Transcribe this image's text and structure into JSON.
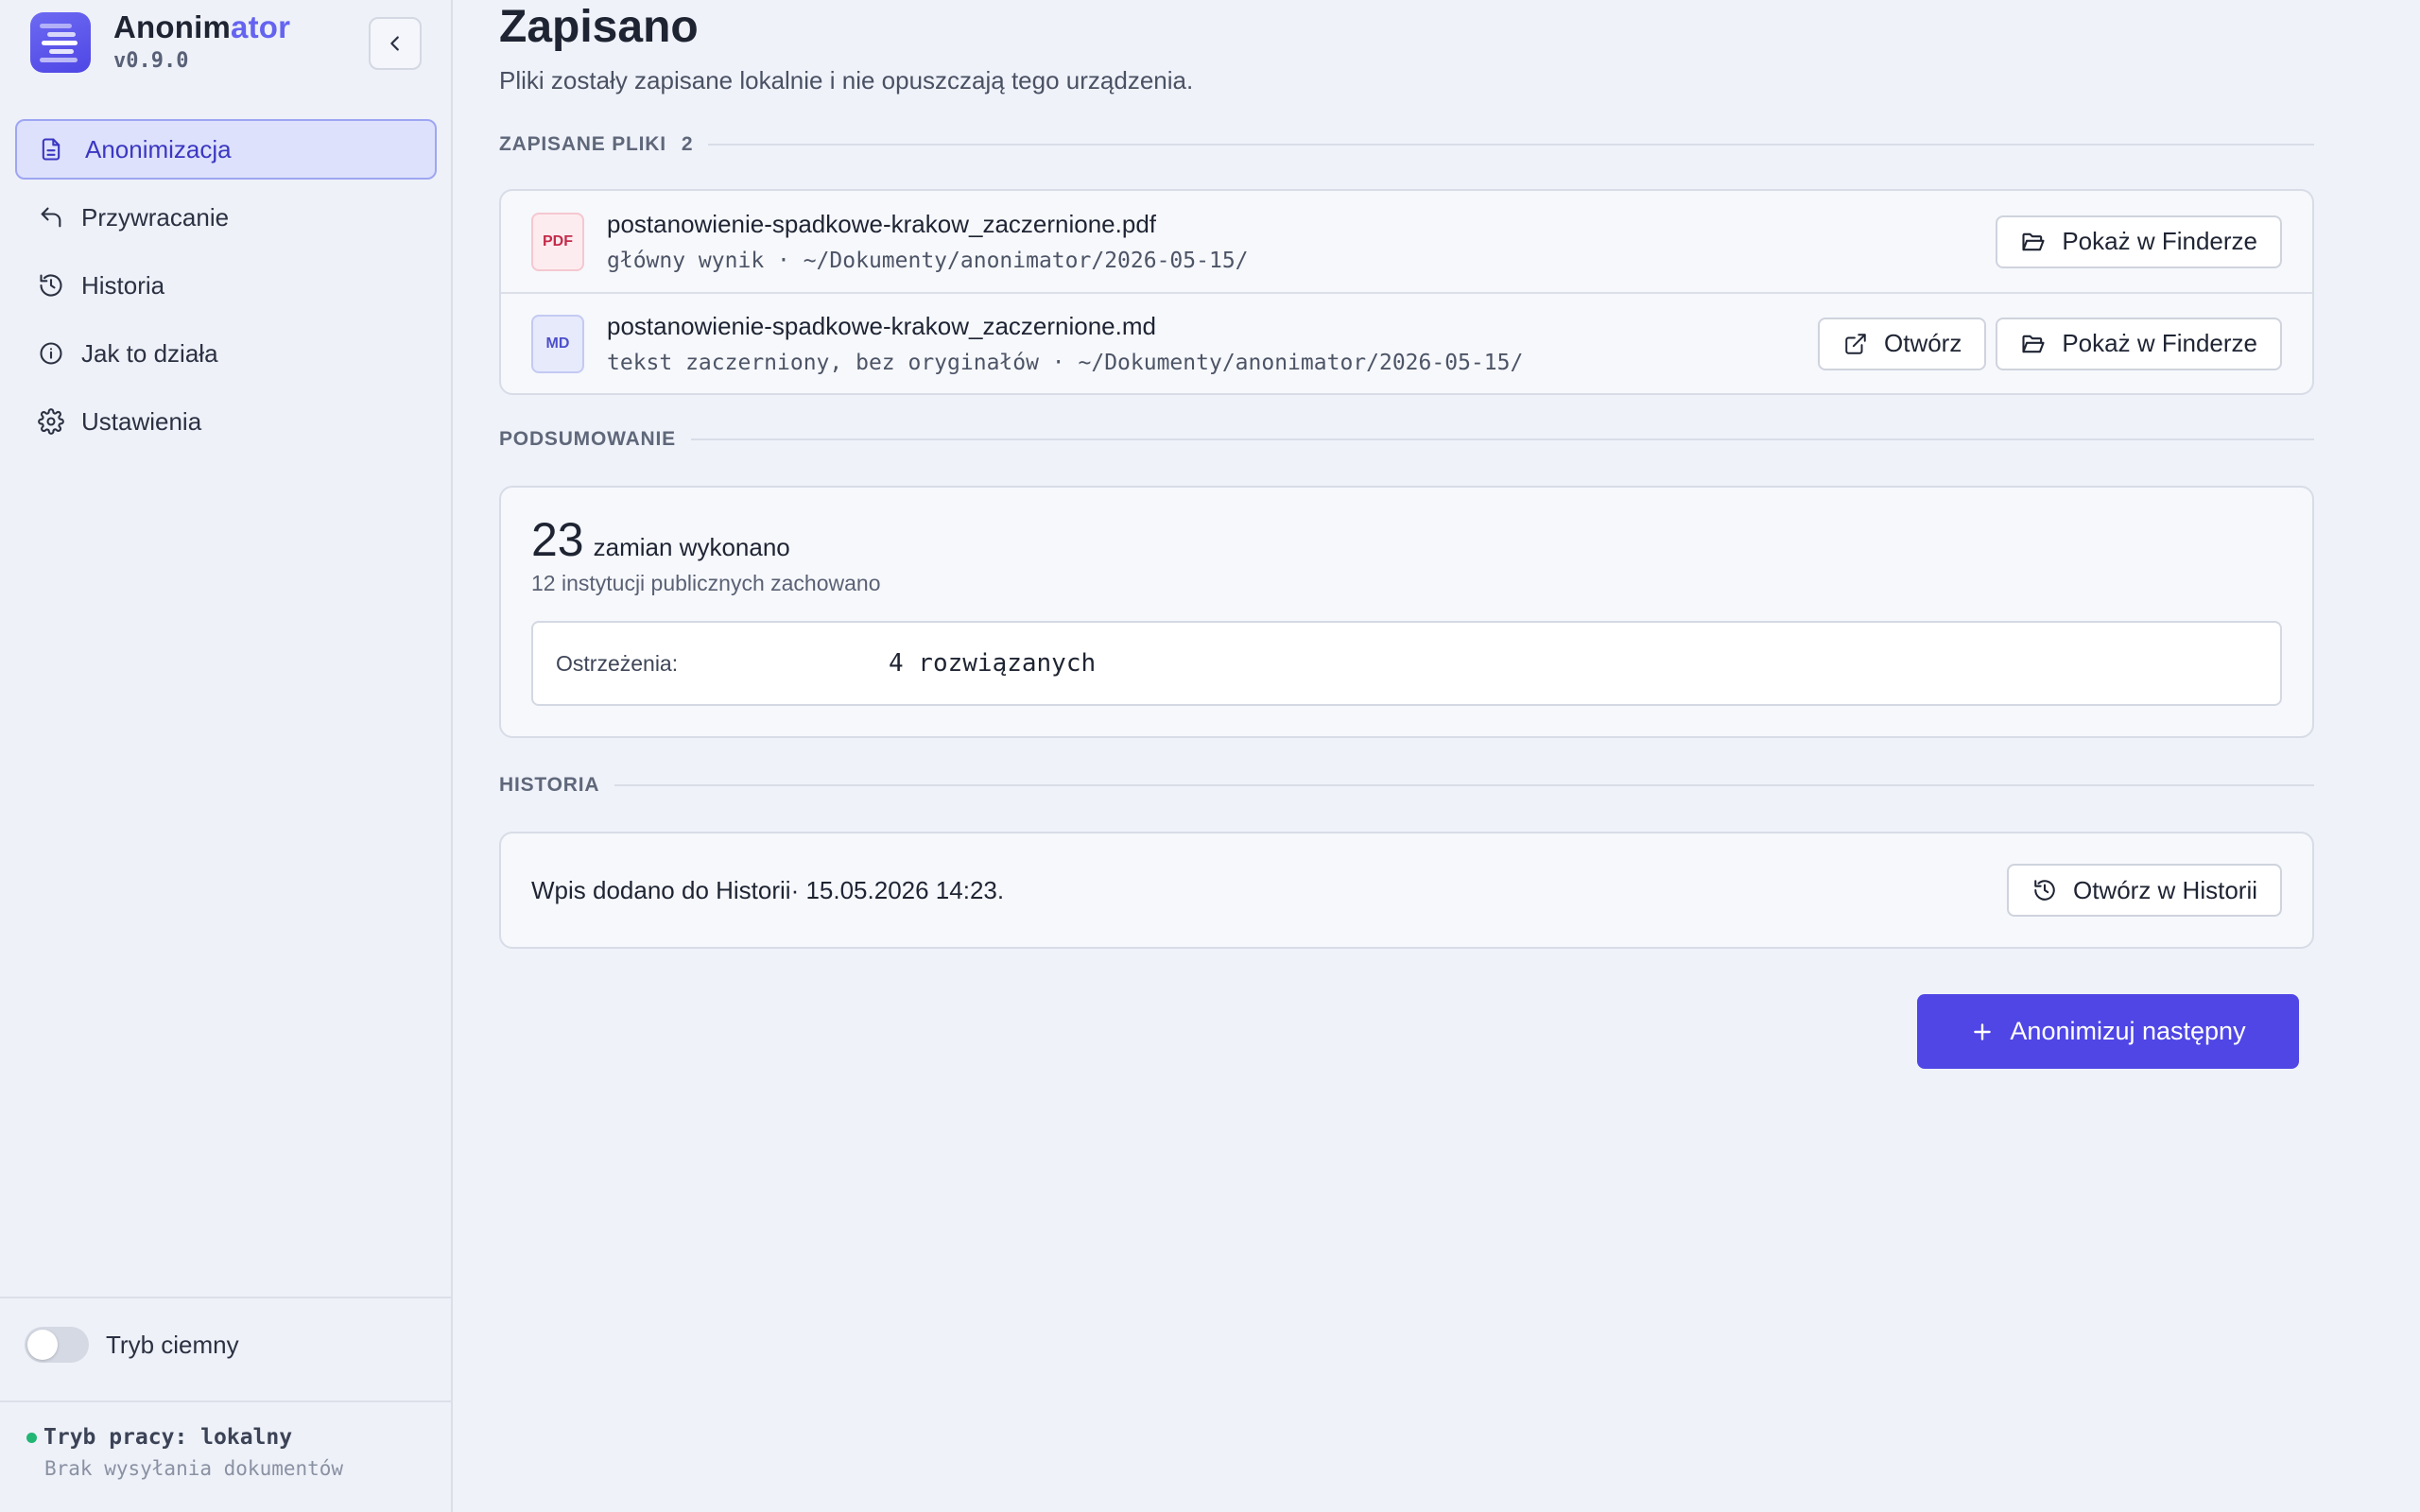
{
  "app": {
    "name_part1": "Anonim",
    "name_part2": "ator",
    "version": "v0.9.0"
  },
  "sidebar": {
    "items": [
      {
        "label": "Anonimizacja",
        "icon": "document-icon",
        "active": true
      },
      {
        "label": "Przywracanie",
        "icon": "undo-arrow-icon",
        "active": false
      },
      {
        "label": "Historia",
        "icon": "history-icon",
        "active": false
      },
      {
        "label": "Jak to działa",
        "icon": "info-icon",
        "active": false
      },
      {
        "label": "Ustawienia",
        "icon": "gear-icon",
        "active": false
      }
    ],
    "dark_mode_label": "Tryb ciemny",
    "dark_mode_on": false,
    "status_title": "Tryb pracy: lokalny",
    "status_subtitle": "Brak wysyłania dokumentów"
  },
  "main": {
    "title": "Zapisano",
    "subtitle": "Pliki zostały zapisane lokalnie i nie opuszczają tego urządzenia.",
    "saved_section": {
      "label": "ZAPISANE PLIKI",
      "count": "2",
      "files": [
        {
          "badge": "PDF",
          "name": "postanowienie-spadkowe-krakow_zaczernione.pdf",
          "meta": "główny wynik · ~/Dokumenty/anonimator/2026-05-15/",
          "show_label": "Pokaż w Finderze"
        },
        {
          "badge": "MD",
          "name": "postanowienie-spadkowe-krakow_zaczernione.md",
          "meta": "tekst zaczerniony, bez oryginałów · ~/Dokumenty/anonimator/2026-05-15/",
          "open_label": "Otwórz",
          "show_label": "Pokaż w Finderze"
        }
      ]
    },
    "summary_section": {
      "label": "PODSUMOWANIE",
      "replacements_count": "23",
      "replacements_text": "zamian wykonano",
      "institutions_text": "12 instytucji publicznych zachowano",
      "warnings_label": "Ostrzeżenia:",
      "warnings_value": "4 rozwiązanych"
    },
    "history_section": {
      "label": "HISTORIA",
      "entry_text": "Wpis dodano do Historii· 15.05.2026 14:23.",
      "open_label": "Otwórz w Historii"
    },
    "primary_action": "Anonimizuj następny"
  },
  "colors": {
    "accent": "#4f46e5",
    "brand_accent": "#6563f0",
    "status_ok": "#22b573",
    "pdf_badge": "#c42b4a",
    "md_badge": "#4d4fc9"
  }
}
